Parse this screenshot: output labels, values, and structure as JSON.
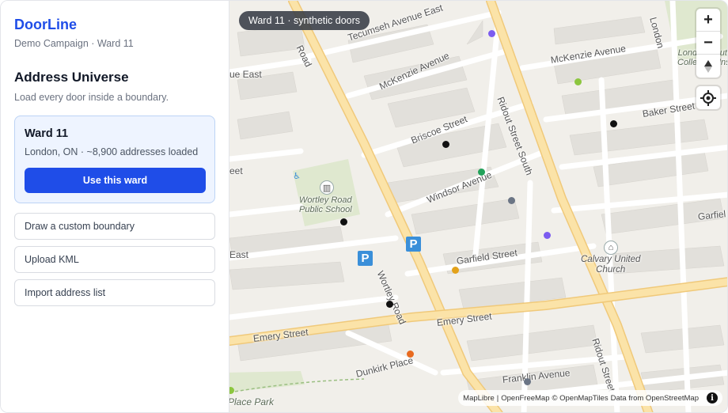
{
  "sidebar": {
    "brand": "DoorLine",
    "campaign": "Demo Campaign · Ward 11",
    "section_title": "Address Universe",
    "section_desc": "Load every door inside a boundary.",
    "ward_card": {
      "name": "Ward 11",
      "meta": "London, ON · ~8,900 addresses loaded",
      "button_label": "Use this ward"
    },
    "options": [
      {
        "label": "Draw a custom boundary"
      },
      {
        "label": "Upload KML"
      },
      {
        "label": "Import address list"
      }
    ]
  },
  "map": {
    "chip": "Ward 11 · synthetic doors",
    "zoom_in": "+",
    "zoom_out": "−",
    "compass": "↑",
    "street_labels": {
      "tecumseh": "Tecumseh Avenue East",
      "mckenzie_left": "McKenzie Avenue",
      "mckenzie_right": "McKenzie Avenue",
      "baker": "Baker Street",
      "briscoe": "Briscoe Street",
      "windsor": "Windsor Avenue",
      "garfield_right": "Garfiel",
      "garfield": "Garfield Street",
      "ridout_south": "Ridout Street South",
      "wortley_top": "Road",
      "wortley": "Wortley Road",
      "emery_left": "Emery Street",
      "emery_right": "Emery Street",
      "dunkirk": "Dunkirk Place",
      "franklin": "Franklin Avenue",
      "ridout_bottom": "Ridout Street",
      "london_top": "London",
      "east_top": "ue East",
      "east_mid": "East",
      "east_left": "eet",
      "place_park": "Place Park"
    },
    "poi_labels": {
      "school": "Wortley Road\nPublic School",
      "church": "Calvary United\nChurch",
      "collegiate": "London South\nCollegiate Inst"
    },
    "attribution": {
      "maplibre": "MapLibre",
      "openfreemap": "OpenFreeMap",
      "openmaptiles": "© OpenMapTiles",
      "osm": "Data from OpenStreetMap",
      "info": "i"
    },
    "door_colors": {
      "purple": "#7c5cf0",
      "lime": "#8cc63f",
      "black": "#111111",
      "green": "#22a15a",
      "gray": "#6b7585",
      "amber": "#e3a21a",
      "orange": "#e86a1f"
    }
  }
}
